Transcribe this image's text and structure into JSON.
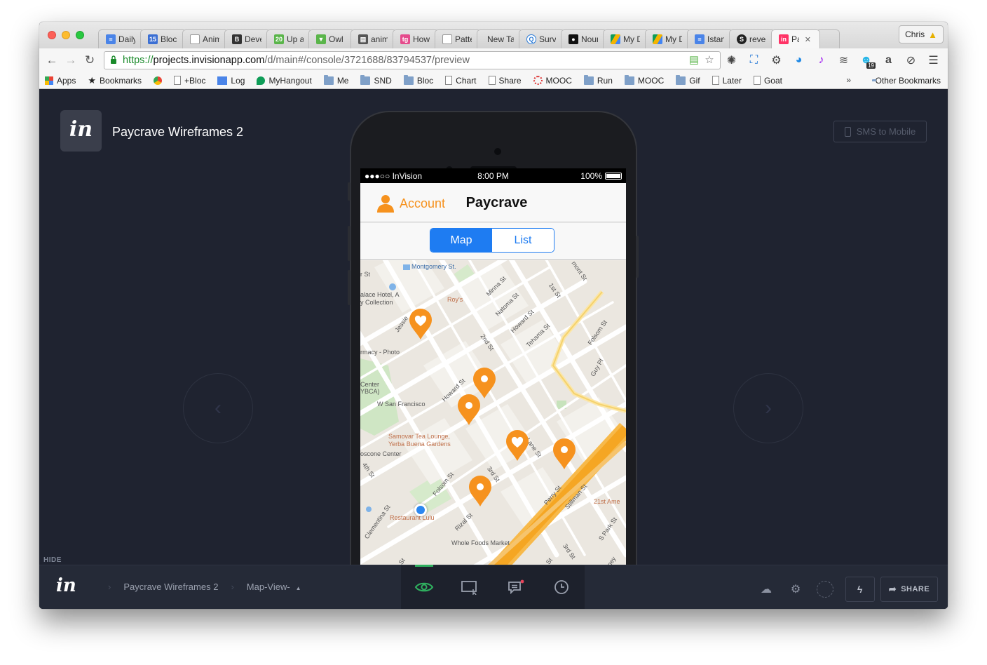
{
  "browser": {
    "tabs": [
      {
        "label": "Daily I",
        "icon": "docs-icon",
        "color": "#4a84e8"
      },
      {
        "label": "Bloc -",
        "icon": "calendar-icon",
        "color": "#3b6fd3"
      },
      {
        "label": "Anima",
        "icon": "page-icon",
        "color": "#ffffff"
      },
      {
        "label": "Devel",
        "icon": "bold-b-icon",
        "color": "#333333"
      },
      {
        "label": "Up an",
        "icon": "calendar-20-icon",
        "color": "#5ab54a"
      },
      {
        "label": "Owl C",
        "icon": "owl-icon",
        "color": "#5ab54a"
      },
      {
        "label": "anima",
        "icon": "book-icon",
        "color": "#555555"
      },
      {
        "label": "How T",
        "icon": "tg-icon",
        "color": "#e54b8c"
      },
      {
        "label": "Patter",
        "icon": "page-icon",
        "color": "#ffffff"
      },
      {
        "label": "New Tab",
        "icon": "",
        "color": ""
      },
      {
        "label": "Surve",
        "icon": "survey-icon",
        "color": "#2a7ad6"
      },
      {
        "label": "Nouni",
        "icon": "noun-icon",
        "color": "#111111"
      },
      {
        "label": "My Dr",
        "icon": "drive-icon",
        "color": "#f4b400"
      },
      {
        "label": "My Dr",
        "icon": "drive-icon",
        "color": "#f4b400"
      },
      {
        "label": "Istanb",
        "icon": "docs-icon",
        "color": "#4a84e8"
      },
      {
        "label": "reveal",
        "icon": "s-icon",
        "color": "#222222"
      },
      {
        "label": "Pa",
        "icon": "invision-icon",
        "color": "#ff3366",
        "active": true
      }
    ],
    "profile_name": "Chris",
    "url": {
      "scheme": "https://",
      "host": "projects.invisionapp.com",
      "path": "/d/main#/console/3721688/83794537/preview"
    },
    "extension_badge": "19",
    "bookmarks": [
      {
        "label": "Apps",
        "icon": "apps-grid-icon"
      },
      {
        "label": "Bookmarks",
        "icon": "star-icon"
      },
      {
        "label": "",
        "icon": "chrome-icon"
      },
      {
        "label": "+Bloc",
        "icon": "page-icon"
      },
      {
        "label": "Log",
        "icon": "docs-icon"
      },
      {
        "label": "MyHangout",
        "icon": "hangout-icon"
      },
      {
        "label": "Me",
        "icon": "folder-icon"
      },
      {
        "label": "SND",
        "icon": "folder-icon"
      },
      {
        "label": "Bloc",
        "icon": "folder-icon"
      },
      {
        "label": "Chart",
        "icon": "page-icon"
      },
      {
        "label": "Share",
        "icon": "page-icon"
      },
      {
        "label": "MOOC",
        "icon": "spinner-icon"
      },
      {
        "label": "Run",
        "icon": "folder-icon"
      },
      {
        "label": "MOOC",
        "icon": "folder-icon"
      },
      {
        "label": "Gif",
        "icon": "folder-icon"
      },
      {
        "label": "Later",
        "icon": "page-icon"
      },
      {
        "label": "Goat",
        "icon": "page-icon"
      }
    ],
    "bookmarks_more": "»",
    "other_bookmarks": "Other Bookmarks"
  },
  "invision": {
    "logo": "in",
    "project_title": "Paycrave Wireframes 2",
    "sms_button": "SMS to Mobile",
    "prev_arrow": "‹",
    "next_arrow": "›",
    "hide_label": "HIDE",
    "breadcrumb": {
      "project": "Paycrave Wireframes 2",
      "screen": "Map-View-",
      "sep": "›",
      "caret": "▲"
    },
    "share_label": "SHARE",
    "colors": {
      "mode_active": "#2fb05f",
      "accent_dot": "#e8435a"
    }
  },
  "phone": {
    "status": {
      "carrier": "●●●○○ InVision",
      "time": "8:00 PM",
      "battery": "100%"
    },
    "header": {
      "account": "Account",
      "title": "Paycrave"
    },
    "segments": {
      "map": "Map",
      "list": "List"
    },
    "map": {
      "street_labels": [
        "Montgomery St.",
        "r St",
        "alace Hotel, A",
        "y Collection",
        "Roy's",
        "Jessie",
        "Minna St",
        "Natoma St",
        "Howard St",
        "Tehama St",
        "1st St",
        "mont St",
        "Folsom St",
        "Guy Pl",
        "rmacy - Photo",
        "Center",
        "YBCA)",
        "W San Francisco",
        "2nd St",
        "Howard St",
        "Samovar Tea Lounge,",
        "Yerba Buena Gardens",
        "oscone Center",
        "4th St",
        "Clementina St",
        "Lane St",
        "Perry St",
        "Stillman St",
        "21st Ame",
        "Folsom St",
        "3rd St",
        "Restaurant Lulu",
        "Rizal St",
        "Whole Foods Market",
        "S Park St",
        "3rd St",
        "Harney Pl",
        "Tehama St",
        "ley St"
      ],
      "pins": [
        "heart-pin-icon",
        "location-pin-icon",
        "location-pin-icon",
        "heart-pin-icon",
        "location-pin-icon",
        "location-pin-icon"
      ],
      "colors": {
        "pin": "#f6921e",
        "user_dot": "#2b87f0",
        "highway": "#f5a623"
      }
    }
  }
}
